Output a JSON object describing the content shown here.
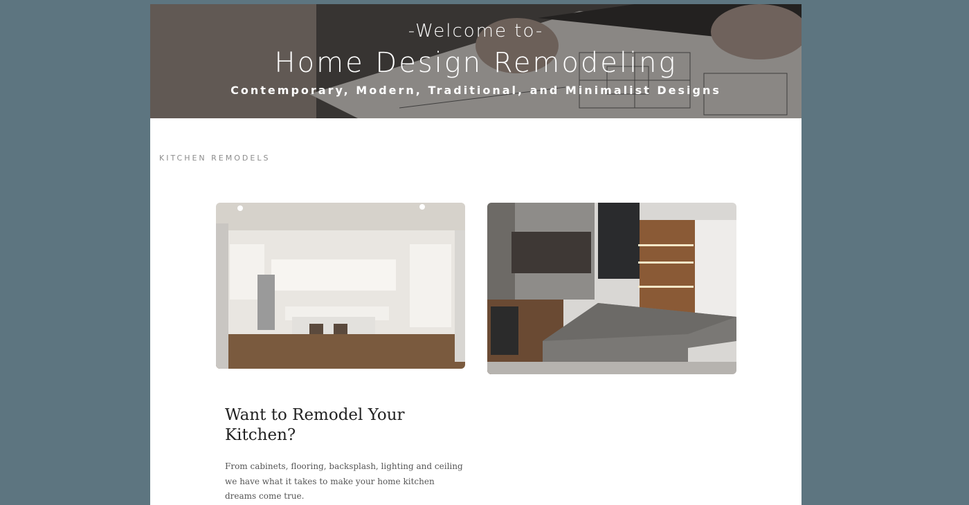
{
  "hero": {
    "welcome": "-Welcome to-",
    "title": "Home Design Remodeling",
    "subtitle": "Contemporary, Modern, Traditional, and Minimalist Designs"
  },
  "section": {
    "label": "KITCHEN REMODELS"
  },
  "gallery": [
    {
      "icon": "white-kitchen-photo"
    },
    {
      "icon": "modern-kitchen-photo"
    }
  ],
  "cta": {
    "heading": "Want to Remodel Your Kitchen?",
    "body": "From cabinets, flooring, backsplash, lighting and ceiling we have what it takes to make your home kitchen dreams come true."
  },
  "colors": {
    "background": "#5d7580",
    "page": "#ffffff",
    "label": "#8c8c8c"
  }
}
